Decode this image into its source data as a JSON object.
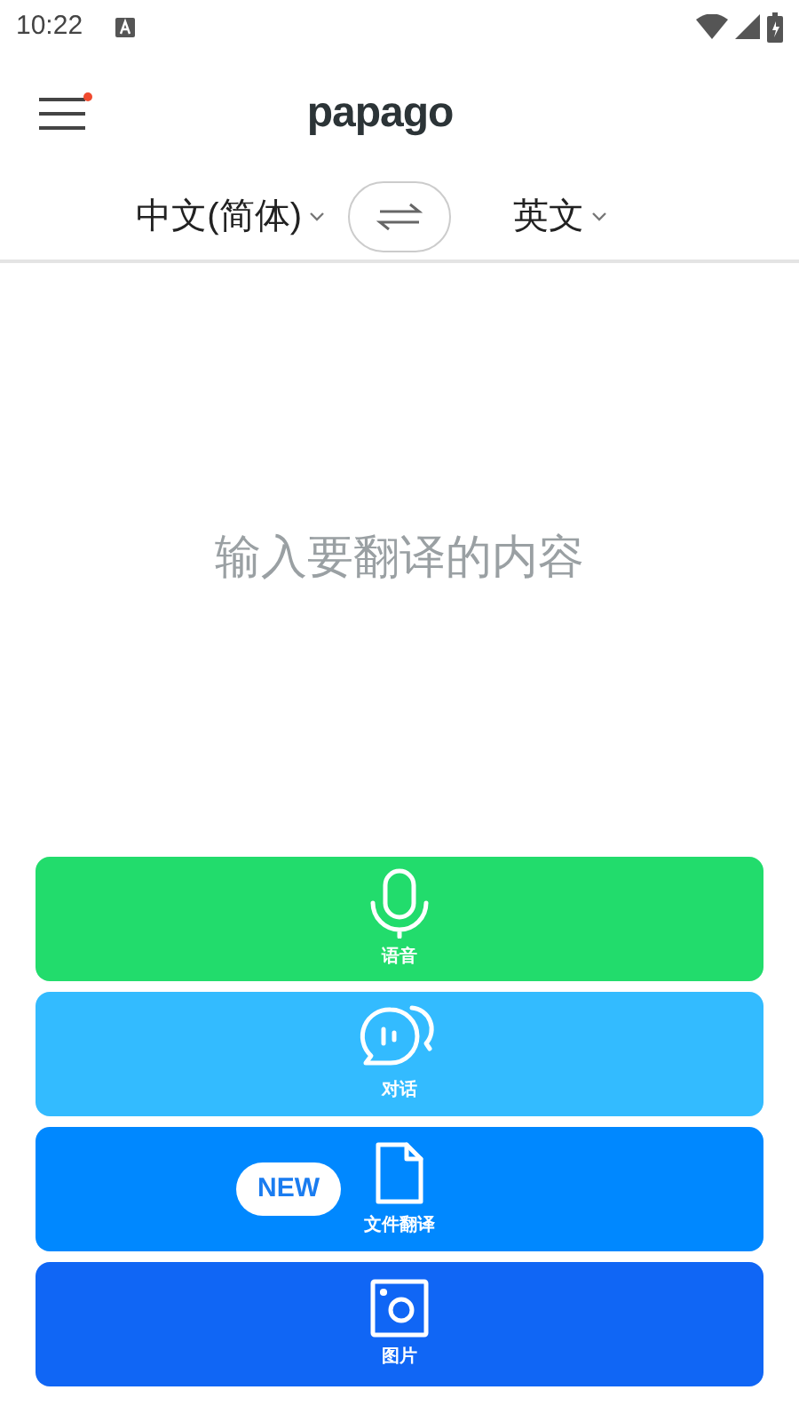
{
  "status_bar": {
    "time": "10:22"
  },
  "header": {
    "logo": "papago",
    "menu_badge": true
  },
  "languages": {
    "source": "中文(简体)",
    "target": "英文"
  },
  "input": {
    "placeholder": "输入要翻译的内容"
  },
  "actions": [
    {
      "kind": "voice",
      "label": "语音",
      "color": "#22dc6c"
    },
    {
      "kind": "conversation",
      "label": "对话",
      "color": "#33bbff"
    },
    {
      "kind": "document",
      "label": "文件翻译",
      "color": "#0088ff",
      "badge": "NEW"
    },
    {
      "kind": "image",
      "label": "图片",
      "color": "#1066f5"
    }
  ]
}
